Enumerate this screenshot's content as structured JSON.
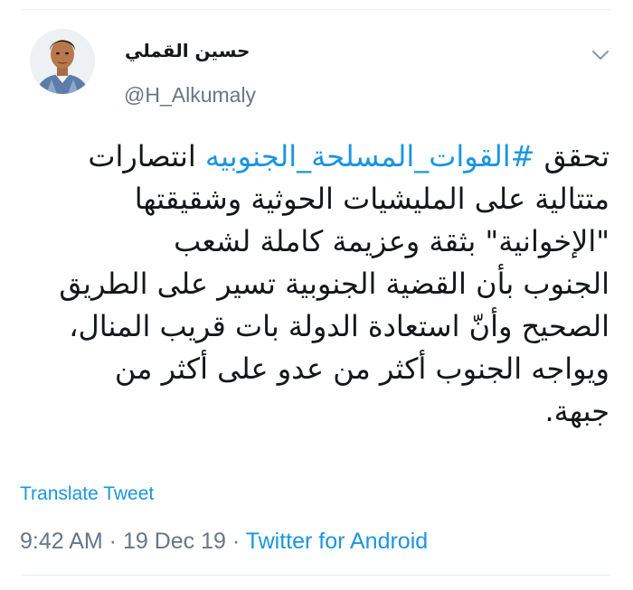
{
  "author": {
    "display_name": "حسين القملي",
    "handle": "@H_Alkumaly"
  },
  "tweet": {
    "lines": [
      {
        "before": "تحقق ",
        "hashtag": "#القوات_المسلحة_الجنوبيه",
        "after": " انتصارات"
      },
      {
        "text": "متتالية على المليشيات الحوثية وشقيقتها"
      },
      {
        "text": "\"الإخوانية\" بثقة وعزيمة كاملة لشعب"
      },
      {
        "text": "الجنوب بأن القضية الجنوبية تسير على الطريق"
      },
      {
        "text": "الصحيح وأنّ استعادة الدولة بات قريب المنال،"
      },
      {
        "text": "ويواجه الجنوب أكثر من عدو على أكثر من"
      },
      {
        "text": "جبهة."
      }
    ]
  },
  "actions": {
    "translate_label": "Translate Tweet"
  },
  "meta": {
    "time": "9:42 AM",
    "separator": " · ",
    "date": "19 Dec 19",
    "source": "Twitter for Android"
  },
  "colors": {
    "link": "#1b95e0",
    "secondary_text": "#657786",
    "primary_text": "#14171a",
    "divider": "#e6ecf0"
  },
  "icons": {
    "menu": "chevron-down-icon",
    "avatar": "avatar"
  }
}
